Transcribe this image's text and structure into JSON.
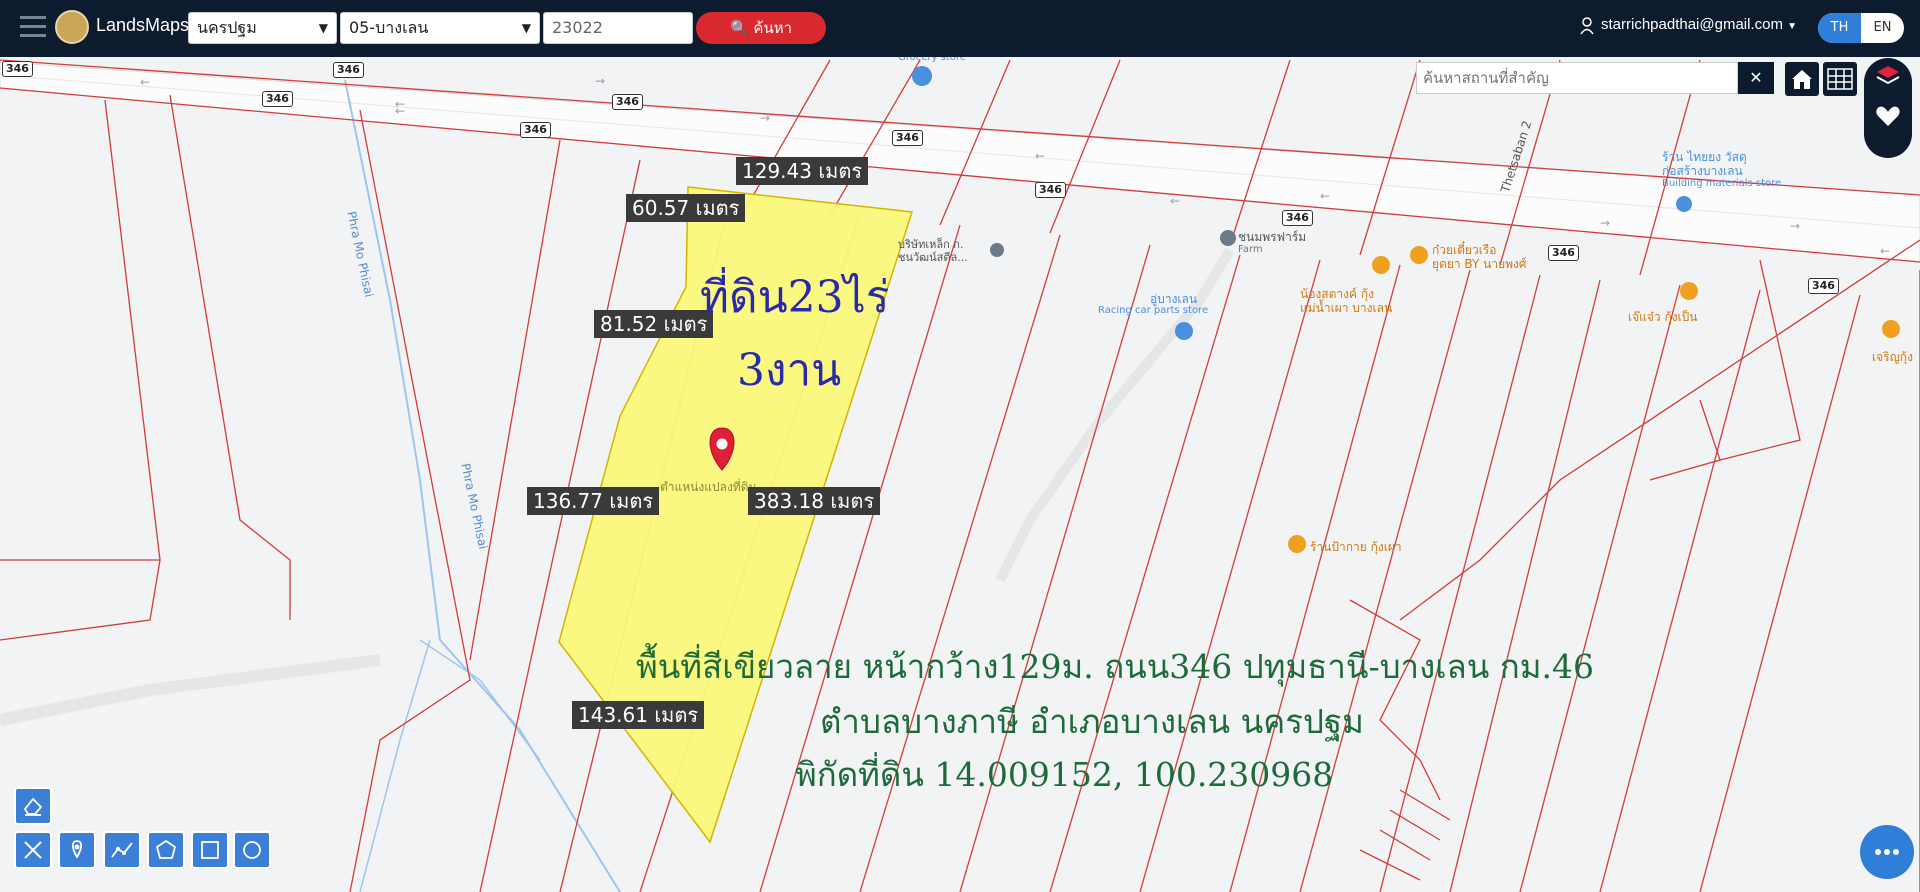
{
  "header": {
    "app_title": "LandsMaps",
    "province": "นครปฐม",
    "district": "05-บางเลน",
    "parcel_number": "23022",
    "search_button_label": "ค้นหา",
    "user_email": "starrichpadthai@gmail.com",
    "lang_th": "TH",
    "lang_en": "EN"
  },
  "place_search": {
    "placeholder": "ค้นหาสถานที่สำคัญ",
    "clear_label": "✕"
  },
  "map": {
    "route_number": "346",
    "pin_label": "ตำแหน่งแปลงที่ดิน",
    "road_labels": {
      "phra_mo_phisai": "Phra Mo Phisai",
      "thetsaban_2": "Thetsaban 2"
    },
    "pois": {
      "grocery": "Grocery store",
      "steel": "บริษัทเหล็ก ก.\nชนวัฒน์สตีล...",
      "farm": "ชนมพรฟาร์ม",
      "farm_sub": "Farm",
      "racing": "อู่บางเลน",
      "racing_sub": "Racing car parts store",
      "noodle1": "ก๋วยเตี๋ยวเรือ\nยุดยา BY นายพงศ์",
      "noodle2": "น้องสตางค์ กุ้ง\nแม่น้ำเผา บางเลน",
      "building": "ร้าน ไทยยง วัสดุ\nก่อสร้างบางเลน",
      "building_sub": "Building materials store",
      "shrimp1": "เจ๊แจ๋ว กุ้งเป็น",
      "shrimp2": "เจริญกุ้ง",
      "shrimp3": "ร้านป้ากาย กุ้งเผา"
    }
  },
  "measurements": {
    "north": "129.43 เมตร",
    "nw_upper": "60.57 เมตร",
    "nw_lower": "81.52 เมตร",
    "west": "136.77 เมตร",
    "east": "383.18 เมตร",
    "sw": "143.61 เมตร"
  },
  "annotations": {
    "area_line1": "ที่ดิน23ไร่",
    "area_line2": "3งาน",
    "desc_line1": "พื้นที่สีเขียวลาย หน้ากว้าง129ม. ถนน346 ปทุมธานี-บางเลน กม.46",
    "desc_line2": "ตำบลบางภาษี อำเภอบางเลน นครปฐม",
    "desc_line3": "พิกัดที่ดิน 14.009152, 100.230968"
  },
  "colors": {
    "topbar": "#0d1b2e",
    "parcel_fill": "#faf87a",
    "parcel_line": "#d43b3b",
    "search_button": "#d9292f",
    "area_text": "#2a2aa8",
    "desc_text": "#1d6b3a",
    "tool_button": "#3b7fd6"
  }
}
